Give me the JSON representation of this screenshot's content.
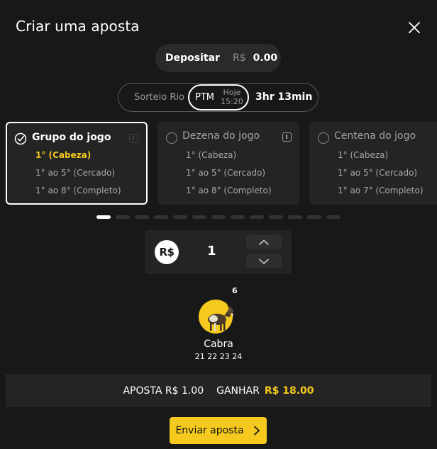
{
  "header": {
    "title": "Criar uma aposta"
  },
  "deposit": {
    "label": "Depositar",
    "currency": "R$",
    "balance": "0.00"
  },
  "draw": {
    "lottery": "Sorteio Rio",
    "selected": "PTM",
    "day": "Hoje",
    "time": "15:20",
    "countdown": "3hr 13min"
  },
  "games": [
    {
      "title": "Grupo do jogo",
      "options": [
        "1° (Cabeza)",
        "1° ao 5° (Cercado)",
        "1° ao 8° (Completo)"
      ]
    },
    {
      "title": "Dezena do jogo",
      "options": [
        "1° (Cabeza)",
        "1° ao 5° (Cercado)",
        "1° ao 8° (Completo)"
      ]
    },
    {
      "title": "Centena do jogo",
      "options": [
        "1° (Cabeza)",
        "1° ao 5° (Cercado)",
        "1° ao 7° (Completo)"
      ]
    }
  ],
  "stake": {
    "currency_badge": "R$",
    "quantity": "1"
  },
  "animal": {
    "group_number": "6",
    "name": "Cabra",
    "numbers": "21 22 23 24"
  },
  "summary": {
    "bet_label": "APOSTA R$ 1.00",
    "win_label": "GANHAR",
    "win_value": "R$ 18.00"
  },
  "submit": {
    "label": "Enviar aposta"
  },
  "colors": {
    "background": "#181818",
    "panel": "#242424",
    "accent": "#f5c91d"
  }
}
